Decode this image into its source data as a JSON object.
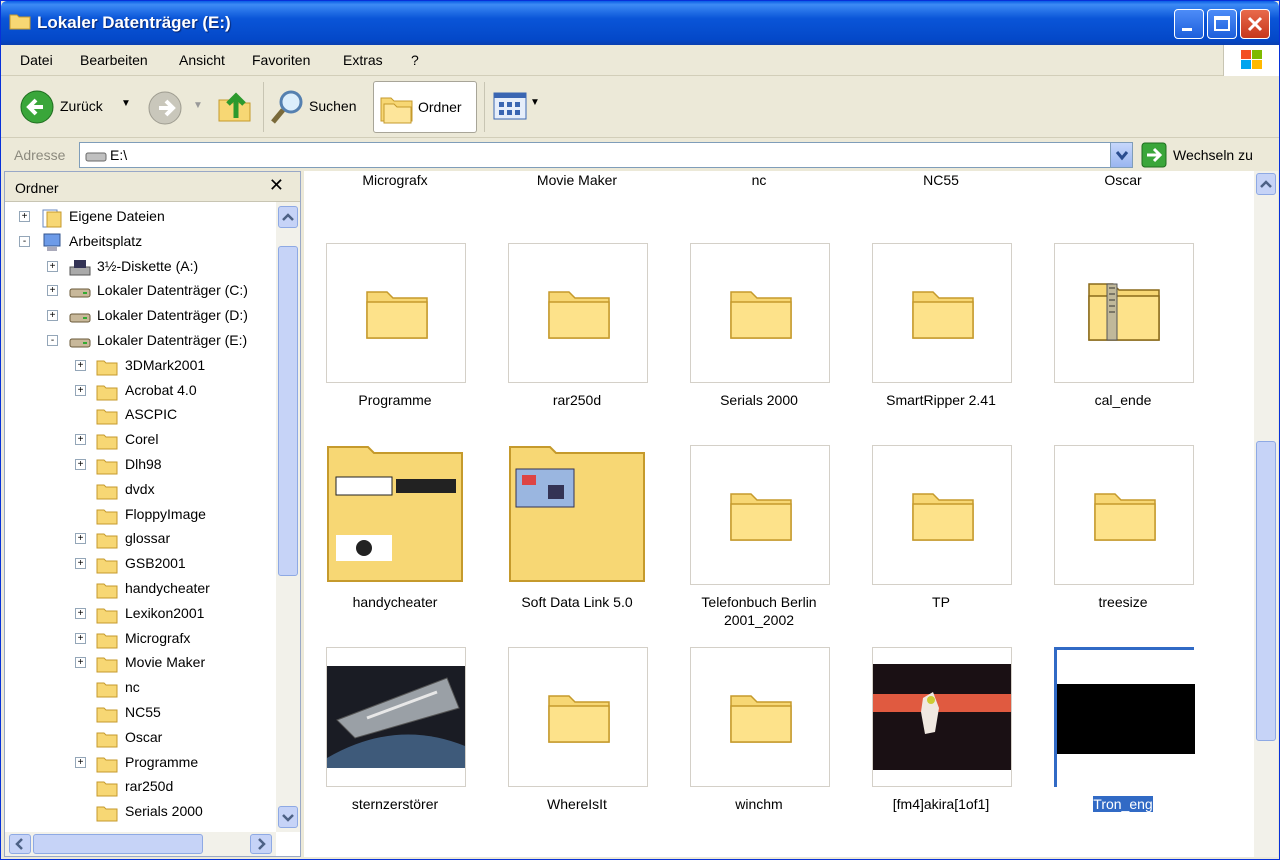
{
  "window": {
    "title": "Lokaler Datenträger (E:)"
  },
  "menu": [
    "Datei",
    "Bearbeiten",
    "Ansicht",
    "Favoriten",
    "Extras",
    "?"
  ],
  "toolbar": {
    "back_label": "Zurück",
    "search_label": "Suchen",
    "folders_label": "Ordner"
  },
  "address": {
    "label": "Adresse",
    "value": "E:\\",
    "go_label": "Wechseln zu"
  },
  "left_pane": {
    "title": "Ordner"
  },
  "tree": [
    {
      "label": "Eigene Dateien",
      "icon": "my-documents-icon",
      "level": 0,
      "exp": "+"
    },
    {
      "label": "Arbeitsplatz",
      "icon": "my-computer-icon",
      "level": 0,
      "exp": "-"
    },
    {
      "label": "3½-Diskette (A:)",
      "icon": "floppy-drive-icon",
      "level": 1,
      "exp": "+"
    },
    {
      "label": "Lokaler Datenträger (C:)",
      "icon": "hard-drive-icon",
      "level": 1,
      "exp": "+"
    },
    {
      "label": "Lokaler Datenträger (D:)",
      "icon": "hard-drive-icon",
      "level": 1,
      "exp": "+"
    },
    {
      "label": "Lokaler Datenträger (E:)",
      "icon": "hard-drive-icon",
      "level": 1,
      "exp": "-"
    },
    {
      "label": "3DMark2001",
      "icon": "folder-icon",
      "level": 2,
      "exp": "+"
    },
    {
      "label": "Acrobat 4.0",
      "icon": "folder-icon",
      "level": 2,
      "exp": "+"
    },
    {
      "label": "ASCPIC",
      "icon": "folder-icon",
      "level": 2,
      "exp": ""
    },
    {
      "label": "Corel",
      "icon": "folder-icon",
      "level": 2,
      "exp": "+"
    },
    {
      "label": "Dlh98",
      "icon": "folder-icon",
      "level": 2,
      "exp": "+"
    },
    {
      "label": "dvdx",
      "icon": "folder-icon",
      "level": 2,
      "exp": ""
    },
    {
      "label": "FloppyImage",
      "icon": "folder-icon",
      "level": 2,
      "exp": ""
    },
    {
      "label": "glossar",
      "icon": "folder-icon",
      "level": 2,
      "exp": "+"
    },
    {
      "label": "GSB2001",
      "icon": "folder-icon",
      "level": 2,
      "exp": "+"
    },
    {
      "label": "handycheater",
      "icon": "folder-icon",
      "level": 2,
      "exp": ""
    },
    {
      "label": "Lexikon2001",
      "icon": "folder-icon",
      "level": 2,
      "exp": "+"
    },
    {
      "label": "Micrografx",
      "icon": "folder-icon",
      "level": 2,
      "exp": "+"
    },
    {
      "label": "Movie Maker",
      "icon": "folder-icon",
      "level": 2,
      "exp": "+"
    },
    {
      "label": "nc",
      "icon": "folder-icon",
      "level": 2,
      "exp": ""
    },
    {
      "label": "NC55",
      "icon": "folder-icon",
      "level": 2,
      "exp": ""
    },
    {
      "label": "Oscar",
      "icon": "folder-icon",
      "level": 2,
      "exp": ""
    },
    {
      "label": "Programme",
      "icon": "folder-icon",
      "level": 2,
      "exp": "+"
    },
    {
      "label": "rar250d",
      "icon": "folder-icon",
      "level": 2,
      "exp": ""
    },
    {
      "label": "Serials 2000",
      "icon": "folder-icon",
      "level": 2,
      "exp": ""
    }
  ],
  "items_row0": [
    "Micrografx",
    "Movie Maker",
    "nc",
    "NC55",
    "Oscar"
  ],
  "items": [
    {
      "label": "Programme",
      "kind": "folder"
    },
    {
      "label": "rar250d",
      "kind": "folder"
    },
    {
      "label": "Serials 2000",
      "kind": "folder"
    },
    {
      "label": "SmartRipper 2.41",
      "kind": "folder"
    },
    {
      "label": "cal_ende",
      "kind": "zip"
    },
    {
      "label": "handycheater",
      "kind": "folder-preview-a"
    },
    {
      "label": "Soft Data Link 5.0",
      "kind": "folder-preview-b"
    },
    {
      "label": "Telefonbuch Berlin 2001_2002",
      "kind": "folder"
    },
    {
      "label": "TP",
      "kind": "folder"
    },
    {
      "label": "treesize",
      "kind": "folder"
    },
    {
      "label": "sternzerstörer",
      "kind": "image-space"
    },
    {
      "label": "WhereIsIt",
      "kind": "folder"
    },
    {
      "label": "winchm",
      "kind": "folder"
    },
    {
      "label": "[fm4]akira[1of1]",
      "kind": "image-akira"
    },
    {
      "label": "Tron_eng",
      "kind": "video",
      "selected": true
    }
  ],
  "colors": {
    "titlebar": "#0a55d8",
    "selection": "#316ac5",
    "folder": "#f7d774"
  }
}
